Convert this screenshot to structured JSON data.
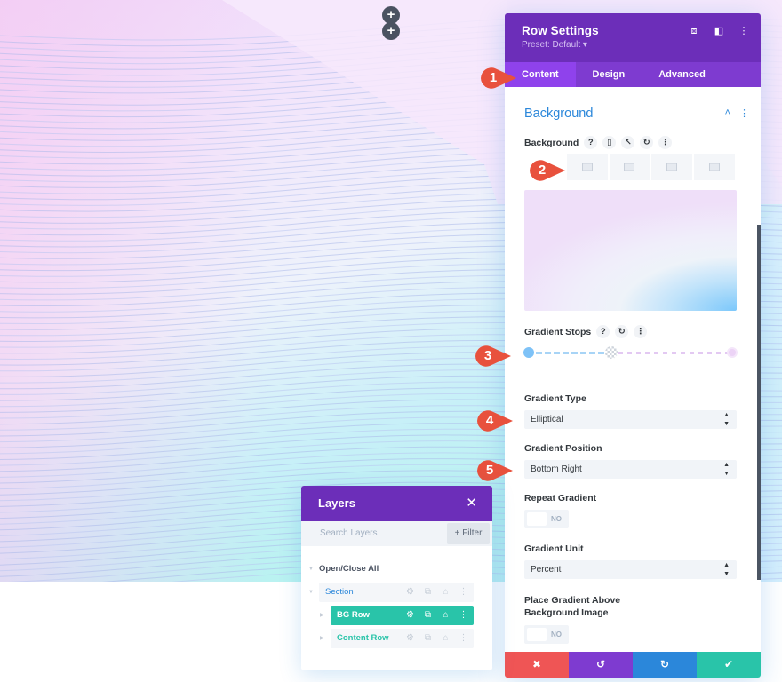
{
  "canvas": {
    "add_buttons": [
      "+",
      "+"
    ]
  },
  "settings": {
    "title": "Row Settings",
    "preset": "Preset: Default ▾",
    "header_icons": [
      "expand-icon",
      "split-view-icon",
      "more-icon"
    ],
    "header_icon_glyphs": [
      "⧈",
      "◧",
      "⋮"
    ],
    "tabs": [
      {
        "label": "Content",
        "active": true
      },
      {
        "label": "Design",
        "active": false
      },
      {
        "label": "Advanced",
        "active": false
      }
    ],
    "section": {
      "title": "Background",
      "collapse_glyph": "˄",
      "more_glyph": "⋮"
    },
    "background": {
      "label": "Background",
      "help_glyph": "?",
      "mobile_glyph": "▯",
      "hover_glyph": "↖",
      "reset_glyph": "↻",
      "more_glyph": "⋮",
      "type_tabs": [
        "gradient",
        "image",
        "video",
        "pattern",
        "mask"
      ],
      "active_type": "gradient"
    },
    "gradient_stops": {
      "label": "Gradient Stops",
      "help_glyph": "?",
      "reset_glyph": "↻",
      "more_glyph": "⋮",
      "stops": [
        {
          "color": "#7ec2f7",
          "position_percent": 0
        },
        {
          "color": "#ecd3f6",
          "position_percent": 100
        }
      ]
    },
    "gradient_type": {
      "label": "Gradient Type",
      "value": "Elliptical"
    },
    "gradient_position": {
      "label": "Gradient Position",
      "value": "Bottom Right"
    },
    "repeat_gradient": {
      "label": "Repeat Gradient",
      "value": "NO"
    },
    "gradient_unit": {
      "label": "Gradient Unit",
      "value": "Percent"
    },
    "place_above": {
      "label_line1": "Place Gradient Above",
      "label_line2": "Background Image",
      "value": "NO"
    },
    "select_arrows": "▲\n▼",
    "footer": {
      "cancel": "✖",
      "undo": "↺",
      "redo": "↻",
      "save": "✔",
      "colors": {
        "cancel": "#ef5555",
        "undo": "#7e3bd0",
        "redo": "#2b87da",
        "save": "#29c4a9"
      }
    }
  },
  "badges": [
    "1",
    "2",
    "3",
    "4",
    "5"
  ],
  "layers": {
    "title": "Layers",
    "close_glyph": "✕",
    "search_placeholder": "Search Layers",
    "filter_label": "+ Filter",
    "open_close_all": "Open/Close All",
    "items": [
      {
        "name": "Section",
        "color": "#2b87da",
        "active": false
      },
      {
        "name": "BG Row",
        "color": "#ffffff",
        "active": true
      },
      {
        "name": "Content Row",
        "color": "#29c4a9",
        "active": false
      }
    ],
    "item_icon_glyphs": [
      "⚙",
      "⧉",
      "⌂",
      "⋮"
    ]
  },
  "colors": {
    "header_purple": "#6c2eb9",
    "tab_purple": "#7e3bd0",
    "active_tab": "#8f42ec",
    "accent_blue": "#2b87da",
    "accent_green": "#29c4a9",
    "badge_red": "#e8513d"
  }
}
